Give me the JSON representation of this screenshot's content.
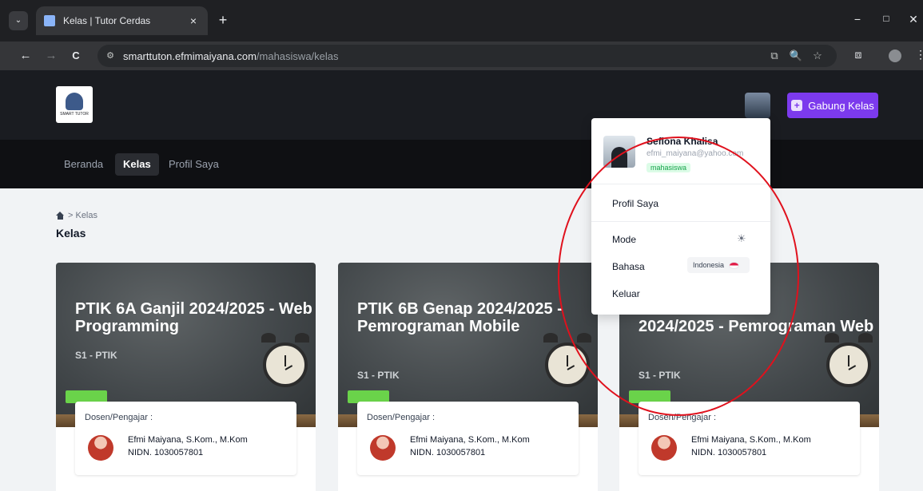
{
  "browser": {
    "tab_title": "Kelas | Tutor Cerdas",
    "tab_close": "×",
    "new_tab": "+",
    "tab_list": "⌄",
    "url_host": "smarttuton.efmimaiyana.com",
    "url_path": "/mahasiswa/kelas",
    "back": "←",
    "forward": "→",
    "reload": "C",
    "site_info_icon": "⚙",
    "translate_icon": "⧉",
    "zoom_icon": "🔍",
    "bookmark_icon": "☆",
    "extensions_icon": "⧈",
    "menu_icon": "⋮",
    "minimize": "−",
    "restore": "□",
    "close": "✕"
  },
  "header": {
    "logo_text": "SMART TUTOR",
    "join_label": "Gabung Kelas",
    "join_plus": "+",
    "accent": "#7c3aed"
  },
  "nav": {
    "items": [
      {
        "label": "Beranda"
      },
      {
        "label": "Kelas"
      },
      {
        "label": "Profil Saya"
      }
    ]
  },
  "breadcrumb": {
    "current": "> Kelas"
  },
  "page": {
    "title": "Kelas"
  },
  "cards": [
    {
      "title": "PTIK 6A Ganjil 2024/2025 - Web Programming",
      "program": "S1 - PTIK",
      "lecturer_label": "Dosen/Pengajar :",
      "lecturer_name": "Efmi Maiyana, S.Kom., M.Kom",
      "lecturer_nidn": "NIDN. 1030057801"
    },
    {
      "title": "PTIK 6B Genap 2024/2025 - Pemrograman Mobile",
      "program": "S1 - PTIK",
      "lecturer_label": "Dosen/Pengajar :",
      "lecturer_name": "Efmi Maiyana, S.Kom., M.Kom",
      "lecturer_nidn": "NIDN. 1030057801"
    },
    {
      "title": "2024/2025 - Pemrograman Web",
      "program": "S1 - PTIK",
      "lecturer_label": "Dosen/Pengajar :",
      "lecturer_name": "Efmi Maiyana, S.Kom., M.Kom",
      "lecturer_nidn": "NIDN. 1030057801"
    }
  ],
  "user_menu": {
    "name": "Sefiona Khalisa",
    "email": "efmi_maiyana@yahoo.com",
    "role": "mahasiswa",
    "profile": "Profil Saya",
    "mode": "Mode",
    "mode_icon": "☀",
    "language": "Bahasa",
    "language_value": "Indonesia",
    "logout": "Keluar"
  }
}
